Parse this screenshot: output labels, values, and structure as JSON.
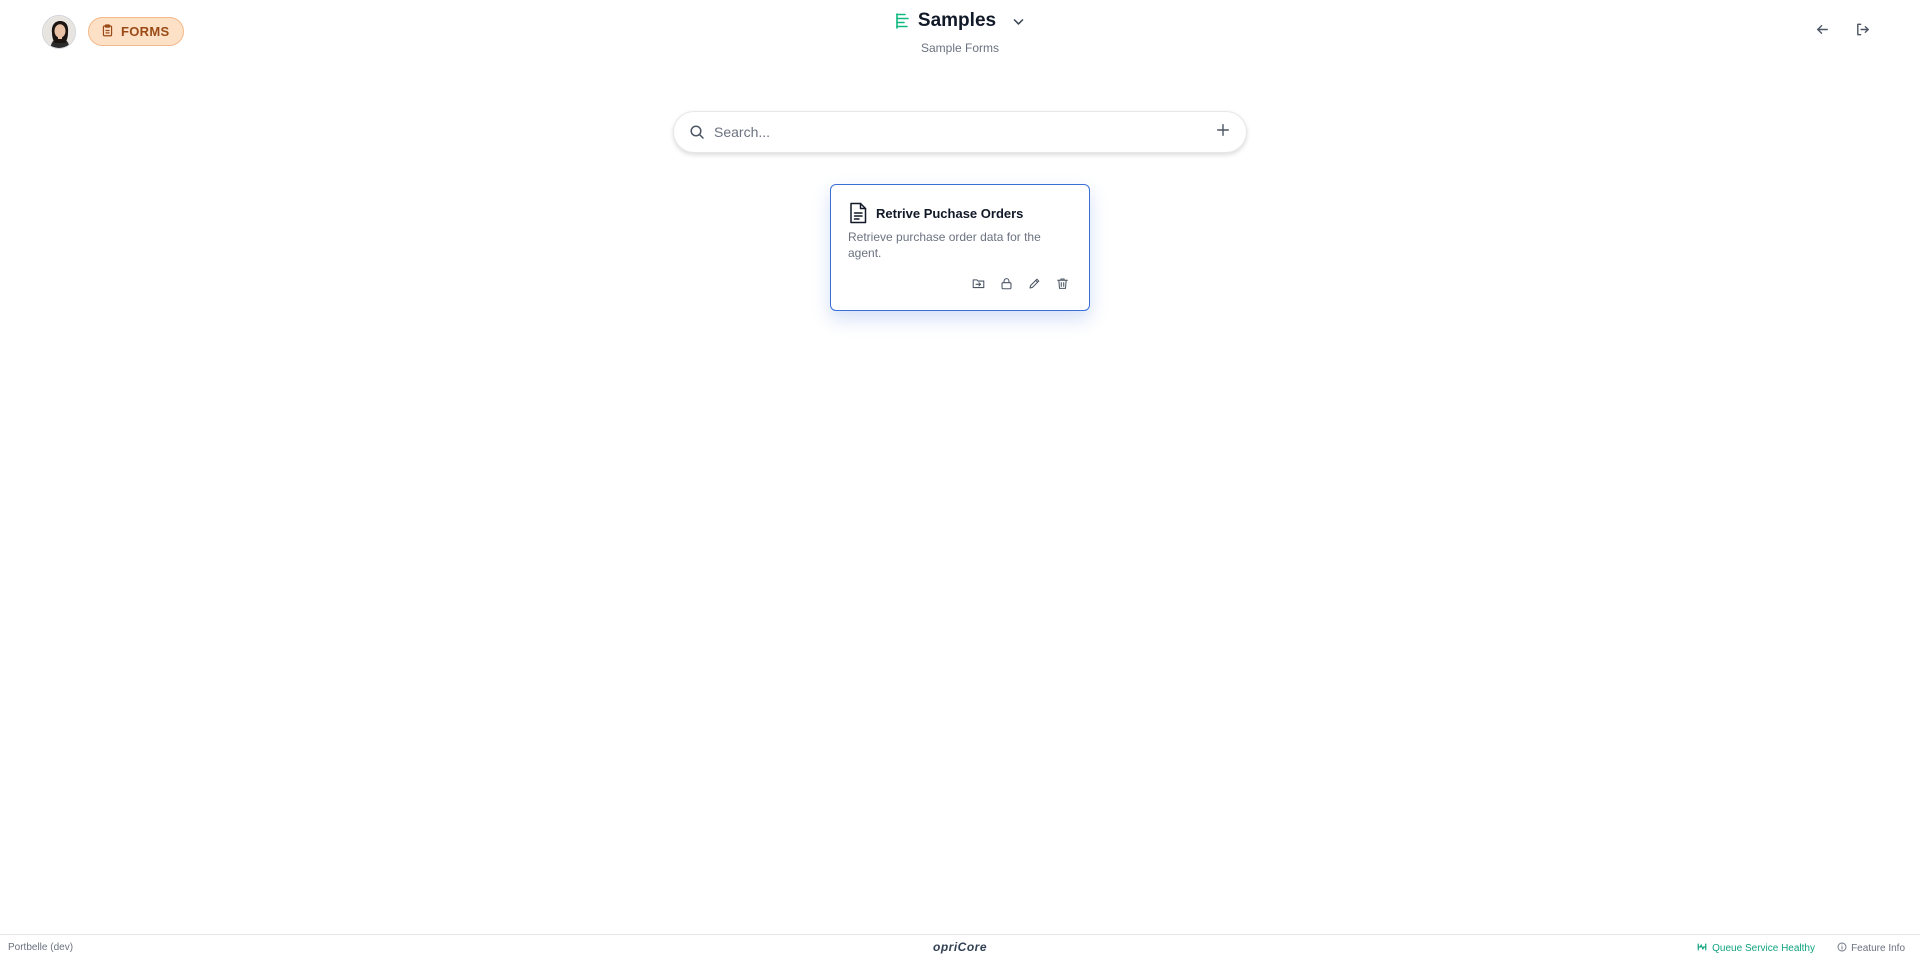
{
  "header": {
    "badge_label": "FORMS",
    "title": "Samples",
    "subtitle": "Sample Forms",
    "icons": {
      "badge": "clipboard-icon",
      "title_logo": "list-icon",
      "title_dropdown": "chevron-down-icon",
      "back": "arrow-left-icon",
      "logout": "logout-icon"
    }
  },
  "search": {
    "placeholder": "Search...",
    "value": "",
    "icons": {
      "search": "search-icon",
      "add": "plus-icon"
    }
  },
  "forms": [
    {
      "title": "Retrive Puchase Orders",
      "description": "Retrieve purchase order data for the agent.",
      "icon": "document-icon",
      "actions": [
        "folder-move-icon",
        "lock-icon",
        "pencil-icon",
        "trash-icon"
      ]
    }
  ],
  "footer": {
    "environment": "Portbelle (dev)",
    "brand": "opriCore",
    "queue_status": "Queue Service Healthy",
    "feature_info": "Feature Info"
  },
  "colors": {
    "badge_bg": "#fde1c7",
    "badge_text": "#9a4a16",
    "card_border": "#3b6fd6",
    "healthy": "#10a37f",
    "title_logo": "#10b981"
  }
}
